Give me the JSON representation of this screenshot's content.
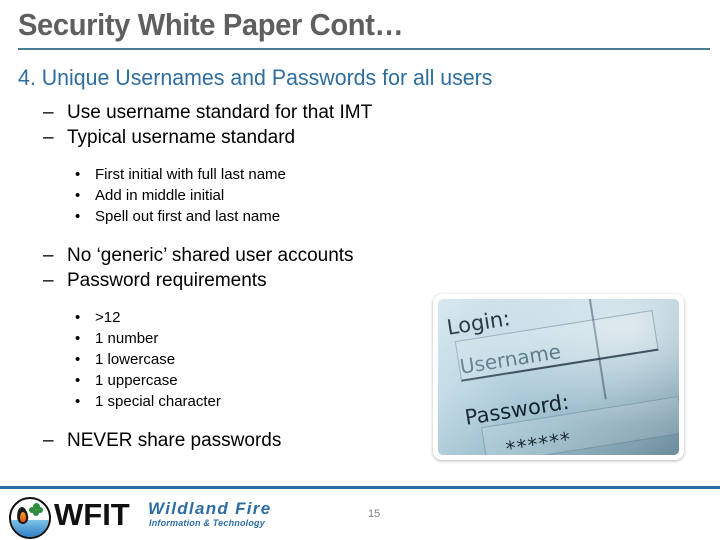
{
  "slide": {
    "title": "Security White Paper Cont…",
    "subtitle": "4. Unique Usernames and Passwords for all users",
    "page_number": "15",
    "accent_color": "#2e6da4",
    "title_rule_color": "#4a7c94",
    "title_color": "#5f5f5f",
    "subtitle_color": "#2e6d9e"
  },
  "bullets": {
    "dash_mark": "–",
    "dot_mark": "•",
    "items": [
      {
        "level": 2,
        "text": "Use username standard for that IMT"
      },
      {
        "level": 2,
        "text": "Typical username standard"
      },
      {
        "level": 3,
        "text": "First initial with full last name"
      },
      {
        "level": 3,
        "text": "Add in middle initial"
      },
      {
        "level": 3,
        "text": "Spell out first and last name"
      },
      {
        "level": 2,
        "text": "No ‘generic’ shared user accounts"
      },
      {
        "level": 2,
        "text": "Password requirements"
      },
      {
        "level": 3,
        "text": ">12"
      },
      {
        "level": 3,
        "text": "1 number"
      },
      {
        "level": 3,
        "text": "1 lowercase"
      },
      {
        "level": 3,
        "text": "1 uppercase"
      },
      {
        "level": 3,
        "text": "1 special character"
      },
      {
        "level": 2,
        "text": "NEVER share passwords"
      }
    ]
  },
  "photo": {
    "alt_name": "login-form-photograph",
    "login_label": "Login:",
    "username_value": "Username",
    "password_label": "Password:",
    "password_masked": "******"
  },
  "footer": {
    "logo_name": "wfit-logo",
    "acronym": "WFIT",
    "tagline_line1": "Wildland Fire",
    "tagline_line2": "Information & Technology"
  }
}
